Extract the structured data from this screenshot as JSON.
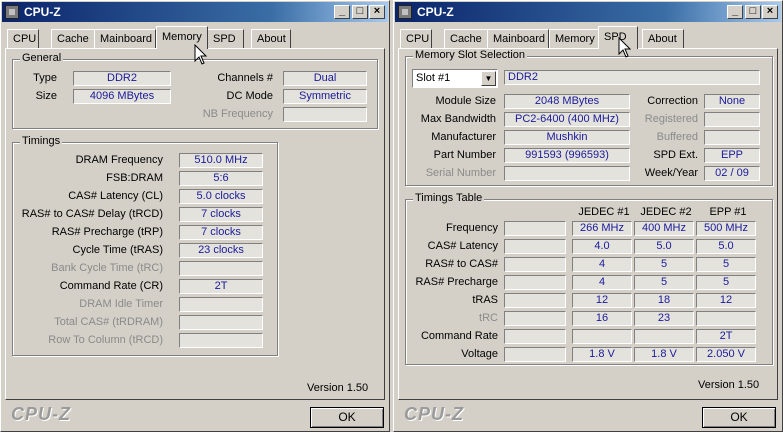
{
  "left": {
    "title": "CPU-Z",
    "tabs": [
      "CPU",
      "Cache",
      "Mainboard",
      "Memory",
      "SPD",
      "About"
    ],
    "active_tab": "Memory",
    "general": {
      "title": "General",
      "type_label": "Type",
      "type_value": "DDR2",
      "size_label": "Size",
      "size_value": "4096 MBytes",
      "channels_label": "Channels #",
      "channels_value": "Dual",
      "dcmode_label": "DC Mode",
      "dcmode_value": "Symmetric",
      "nbfreq_label": "NB Frequency",
      "nbfreq_value": ""
    },
    "timings": {
      "title": "Timings",
      "rows": [
        {
          "label": "DRAM Frequency",
          "value": "510.0 MHz",
          "enabled": true
        },
        {
          "label": "FSB:DRAM",
          "value": "5:6",
          "enabled": true
        },
        {
          "label": "CAS# Latency (CL)",
          "value": "5.0 clocks",
          "enabled": true
        },
        {
          "label": "RAS# to CAS# Delay (tRCD)",
          "value": "7 clocks",
          "enabled": true
        },
        {
          "label": "RAS# Precharge (tRP)",
          "value": "7 clocks",
          "enabled": true
        },
        {
          "label": "Cycle Time (tRAS)",
          "value": "23 clocks",
          "enabled": true
        },
        {
          "label": "Bank Cycle Time (tRC)",
          "value": "",
          "enabled": false
        },
        {
          "label": "Command Rate (CR)",
          "value": "2T",
          "enabled": true
        },
        {
          "label": "DRAM Idle Timer",
          "value": "",
          "enabled": false
        },
        {
          "label": "Total CAS# (tRDRAM)",
          "value": "",
          "enabled": false
        },
        {
          "label": "Row To Column (tRCD)",
          "value": "",
          "enabled": false
        }
      ]
    },
    "version": "Version 1.50",
    "brand": "CPU-Z",
    "ok": "OK"
  },
  "right": {
    "title": "CPU-Z",
    "tabs": [
      "CPU",
      "Cache",
      "Mainboard",
      "Memory",
      "SPD",
      "About"
    ],
    "active_tab": "SPD",
    "slot": {
      "title": "Memory Slot Selection",
      "selected": "Slot #1",
      "type": "DDR2",
      "module_size_label": "Module Size",
      "module_size": "2048 MBytes",
      "max_bw_label": "Max Bandwidth",
      "max_bw": "PC2-6400 (400 MHz)",
      "manufacturer_label": "Manufacturer",
      "manufacturer": "Mushkin",
      "part_label": "Part Number",
      "part": "991593 (996593)",
      "serial_label": "Serial Number",
      "serial": "",
      "correction_label": "Correction",
      "correction": "None",
      "registered_label": "Registered",
      "registered": "",
      "buffered_label": "Buffered",
      "buffered": "",
      "spdext_label": "SPD Ext.",
      "spdext": "EPP",
      "week_label": "Week/Year",
      "week": "02 / 09"
    },
    "timings_table": {
      "title": "Timings Table",
      "headers": [
        "JEDEC #1",
        "JEDEC #2",
        "EPP #1"
      ],
      "rows": [
        {
          "label": "Frequency",
          "enabled": true,
          "values": [
            "266 MHz",
            "400 MHz",
            "500 MHz"
          ]
        },
        {
          "label": "CAS# Latency",
          "enabled": true,
          "values": [
            "4.0",
            "5.0",
            "5.0"
          ]
        },
        {
          "label": "RAS# to CAS#",
          "enabled": true,
          "values": [
            "4",
            "5",
            "5"
          ]
        },
        {
          "label": "RAS# Precharge",
          "enabled": true,
          "values": [
            "4",
            "5",
            "5"
          ]
        },
        {
          "label": "tRAS",
          "enabled": true,
          "values": [
            "12",
            "18",
            "12"
          ]
        },
        {
          "label": "tRC",
          "enabled": false,
          "values": [
            "16",
            "23",
            ""
          ]
        },
        {
          "label": "Command Rate",
          "enabled": true,
          "values": [
            "",
            "",
            "2T"
          ]
        },
        {
          "label": "Voltage",
          "enabled": true,
          "values": [
            "1.8 V",
            "1.8 V",
            "2.050 V"
          ]
        }
      ]
    },
    "version": "Version 1.50",
    "brand": "CPU-Z",
    "ok": "OK"
  }
}
